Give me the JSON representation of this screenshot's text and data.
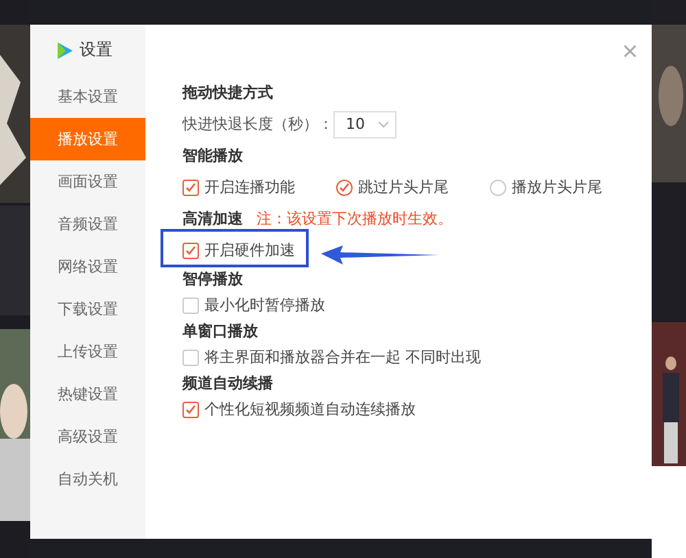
{
  "dialog": {
    "title": "设置",
    "close": "×"
  },
  "sidebar": {
    "items": [
      {
        "label": "基本设置",
        "selected": false
      },
      {
        "label": "播放设置",
        "selected": true
      },
      {
        "label": "画面设置",
        "selected": false
      },
      {
        "label": "音频设置",
        "selected": false
      },
      {
        "label": "网络设置",
        "selected": false
      },
      {
        "label": "下载设置",
        "selected": false
      },
      {
        "label": "上传设置",
        "selected": false
      },
      {
        "label": "热键设置",
        "selected": false
      },
      {
        "label": "高级设置",
        "selected": false
      },
      {
        "label": "自动关机",
        "selected": false
      }
    ]
  },
  "sections": [
    {
      "title": "拖动快捷方式",
      "options": [
        {
          "kind": "select",
          "label": "快进快退长度（秒）：",
          "value": "10"
        }
      ]
    },
    {
      "title": "智能播放",
      "options": [
        {
          "kind": "checkbox",
          "label": "开启连播功能",
          "checked": true
        },
        {
          "kind": "radio",
          "label": "跳过片头片尾",
          "checked": true
        },
        {
          "kind": "radio",
          "label": "播放片头片尾",
          "checked": false
        }
      ]
    },
    {
      "title": "高清加速",
      "note": "注：该设置下次播放时生效。",
      "options": [
        {
          "kind": "checkbox",
          "label": "开启硬件加速",
          "checked": true
        }
      ]
    },
    {
      "title": "智停播放",
      "options": [
        {
          "kind": "checkbox",
          "label": "最小化时暂停播放",
          "checked": false
        }
      ]
    },
    {
      "title": "单窗口播放",
      "options": [
        {
          "kind": "checkbox",
          "label": "将主界面和播放器合并在一起 不同时出现",
          "checked": false
        }
      ]
    },
    {
      "title": "频道自动续播",
      "options": [
        {
          "kind": "checkbox",
          "label": "个性化短视频频道自动连续播放",
          "checked": true
        }
      ]
    }
  ]
}
